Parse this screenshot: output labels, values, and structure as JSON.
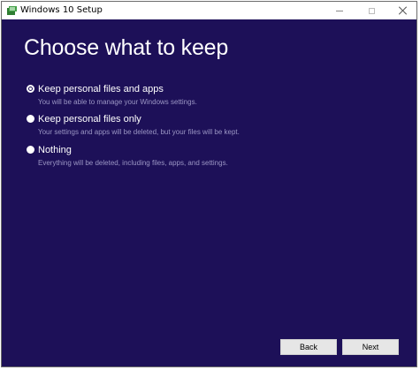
{
  "window": {
    "title": "Windows 10 Setup",
    "icon": "windows-setup-icon",
    "controls": [
      "minimize-icon",
      "maximize-icon",
      "close-icon"
    ]
  },
  "page": {
    "heading": "Choose what to keep"
  },
  "options": [
    {
      "label": "Keep personal files and apps",
      "description": "You will be able to manage your Windows settings.",
      "selected": true
    },
    {
      "label": "Keep personal files only",
      "description": "Your settings and apps will be deleted, but your files will be kept.",
      "selected": false
    },
    {
      "label": "Nothing",
      "description": "Everything will be deleted, including files, apps, and settings.",
      "selected": false
    }
  ],
  "buttons": {
    "back": "Back",
    "next": "Next"
  },
  "colors": {
    "background": "#1d1058",
    "text": "#ffffff",
    "description": "#9b96c4",
    "button": "#e6e6e6"
  }
}
